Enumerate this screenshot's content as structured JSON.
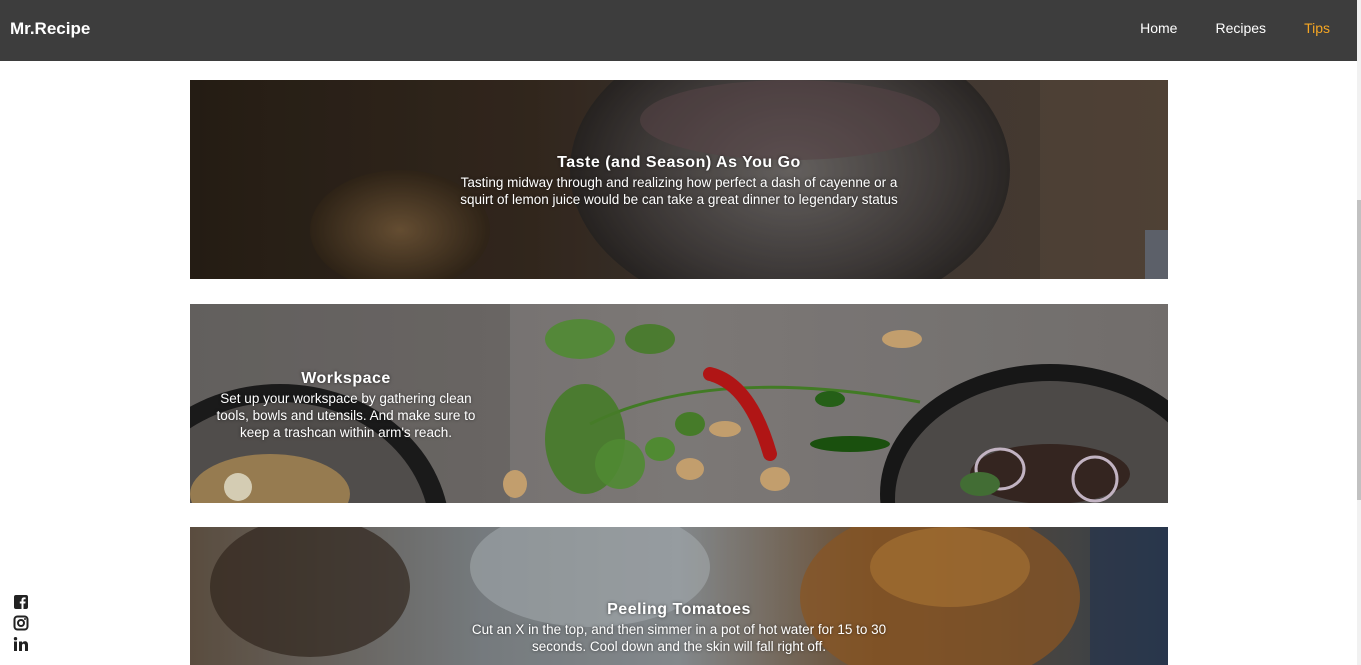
{
  "navbar": {
    "brand": "Mr.Recipe",
    "links": [
      {
        "label": "Home",
        "active": false
      },
      {
        "label": "Recipes",
        "active": false
      },
      {
        "label": "Tips",
        "active": true
      }
    ],
    "active_color": "#f5a623",
    "background": "#3d3d3d"
  },
  "tips": [
    {
      "title": "Taste (and Season) As You Go",
      "description": "Tasting midway through and realizing how perfect a dash of cayenne or a squirt of lemon juice would be can take a great dinner to legendary status"
    },
    {
      "title": "Workspace",
      "description": "Set up your workspace by gathering clean tools, bowls and utensils. And make sure to keep a trashcan within arm's reach."
    },
    {
      "title": "Peeling Tomatoes",
      "description": "Cut an X in the top, and then simmer in a pot of hot water for 15 to 30 seconds. Cool down and the skin will fall right off."
    }
  ],
  "social": {
    "icons": [
      "facebook-icon",
      "instagram-icon",
      "linkedin-icon"
    ]
  }
}
